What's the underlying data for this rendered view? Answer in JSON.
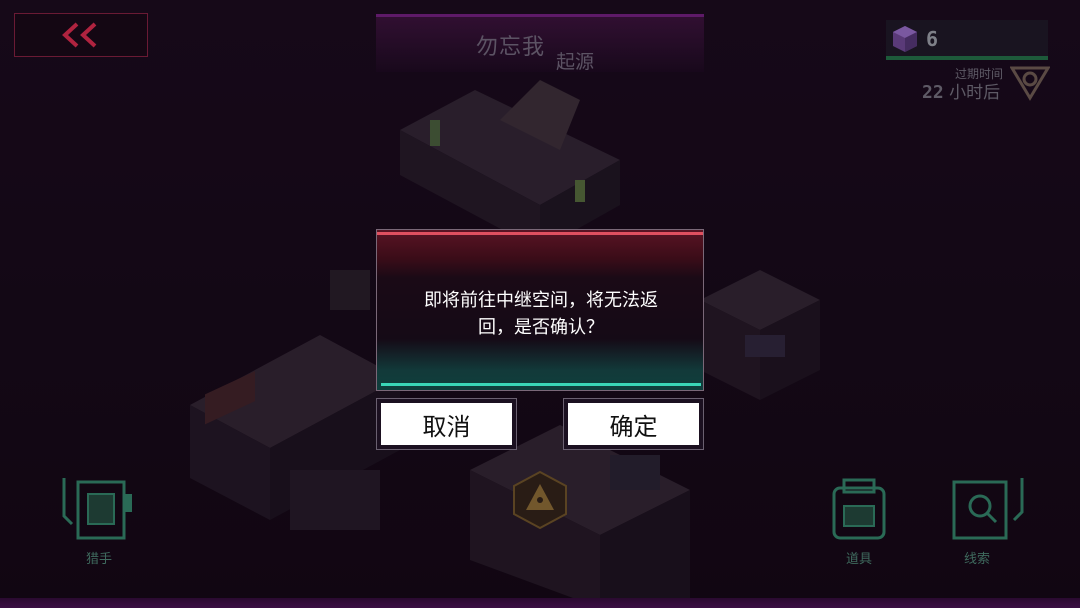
{
  "header": {
    "title": "勿忘我",
    "subtitle": "起源"
  },
  "currency": {
    "count": "6"
  },
  "expire": {
    "label": "过期时间",
    "number": "22",
    "unit": "小时后"
  },
  "dialog": {
    "message_line1": "即将前往中继空间，将无法返",
    "message_line2": "回，是否确认？",
    "cancel_label": "取消",
    "confirm_label": "确定"
  },
  "tools": {
    "hacker_label": "猎手",
    "items_label": "道具",
    "clues_label": "线索"
  },
  "colors": {
    "accent_red": "#e05060",
    "accent_teal": "#3ad6b8",
    "back_arrow": "#b0233f"
  }
}
